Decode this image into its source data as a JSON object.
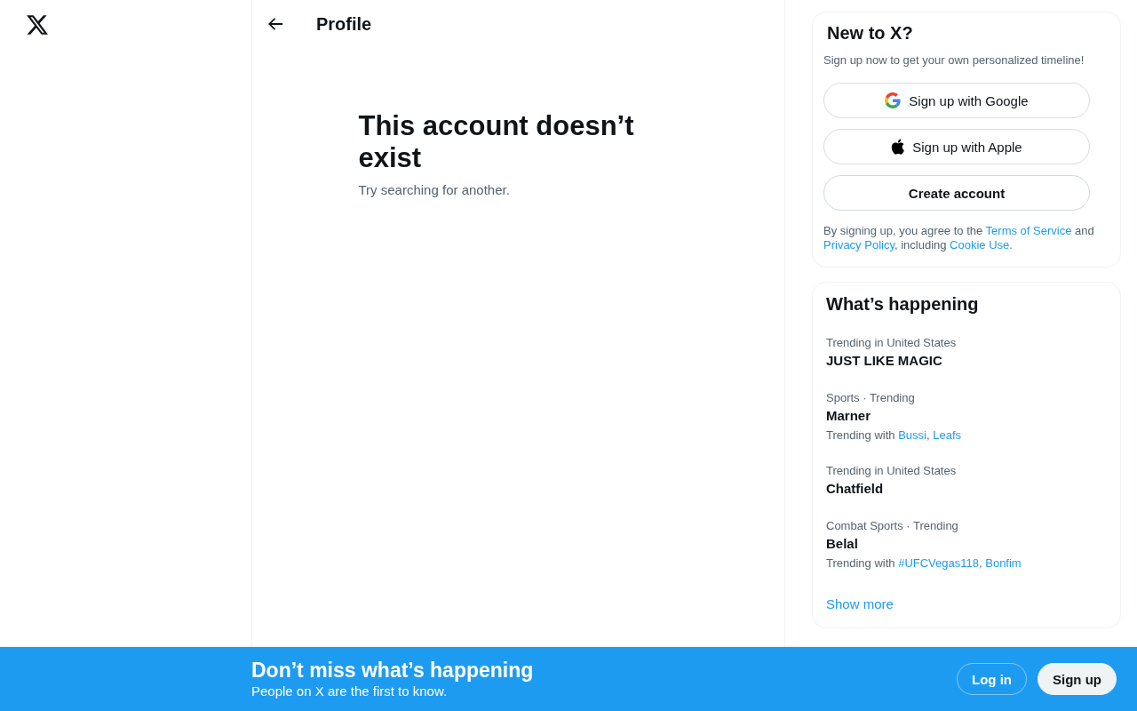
{
  "header": {
    "title": "Profile"
  },
  "empty_state": {
    "title": "This account doesn’t exist",
    "subtitle": "Try searching for another."
  },
  "signup_card": {
    "title": "New to X?",
    "subtitle": "Sign up now to get your own personalized timeline!",
    "buttons": [
      {
        "kind": "google",
        "label": "Sign up with Google"
      },
      {
        "kind": "apple",
        "label": "Sign up with Apple"
      },
      {
        "kind": "plain",
        "label": "Create account"
      }
    ],
    "legal": [
      {
        "kind": "text",
        "text": "By signing up, you agree to the "
      },
      {
        "kind": "link",
        "text": "Terms of Service"
      },
      {
        "kind": "text",
        "text": " and "
      },
      {
        "kind": "link",
        "text": "Privacy Policy"
      },
      {
        "kind": "text",
        "text": ", including "
      },
      {
        "kind": "link",
        "text": "Cookie Use."
      }
    ]
  },
  "trends_card": {
    "title": "What’s happening",
    "trends": [
      {
        "meta": "Trending in United States",
        "name": "JUST LIKE MAGIC"
      },
      {
        "meta": "Sports · Trending",
        "name": "Marner",
        "context": [
          {
            "kind": "text",
            "text": "Trending with "
          },
          {
            "kind": "link",
            "text": "Bussi"
          },
          {
            "kind": "text",
            "text": ", "
          },
          {
            "kind": "link",
            "text": "Leafs"
          }
        ]
      },
      {
        "meta": "Trending in United States",
        "name": "Chatfield"
      },
      {
        "meta": "Combat Sports · Trending",
        "name": "Belal",
        "context": [
          {
            "kind": "text",
            "text": "Trending with "
          },
          {
            "kind": "link",
            "text": "#UFCVegas118"
          },
          {
            "kind": "text",
            "text": ", "
          },
          {
            "kind": "link",
            "text": "Bonfim"
          }
        ]
      }
    ],
    "show_more": "Show more"
  },
  "banner": {
    "title": "Don’t miss what’s happening",
    "subtitle": "People on X are the first to know.",
    "buttons": [
      {
        "kind": "outline",
        "label": "Log in"
      },
      {
        "kind": "filled",
        "label": "Sign up"
      }
    ]
  }
}
